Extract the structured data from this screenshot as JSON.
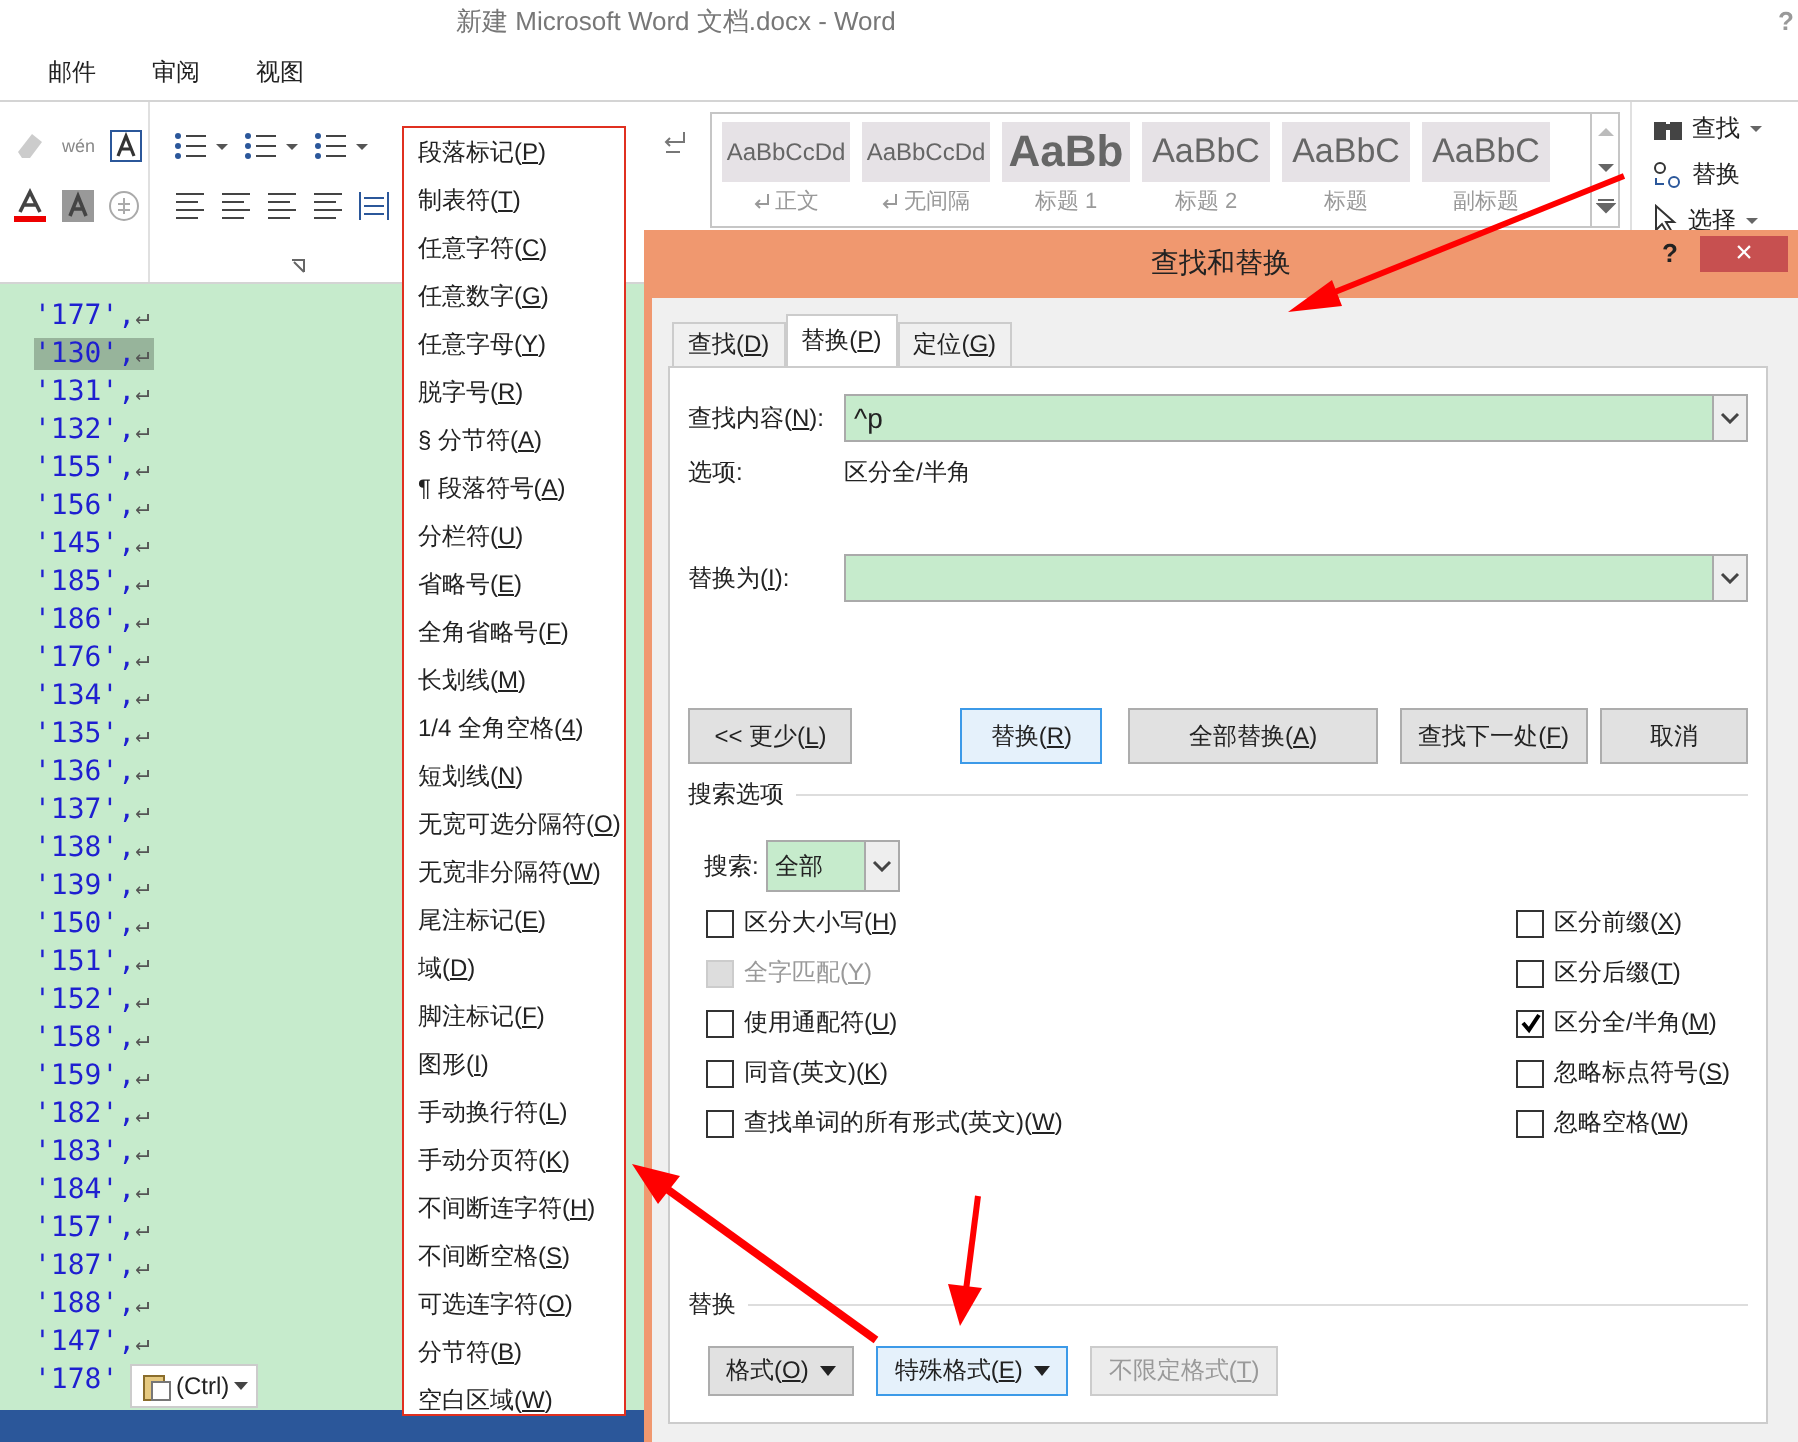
{
  "window": {
    "title": "新建 Microsoft Word 文档.docx - Word",
    "help": "?"
  },
  "ribbon_tabs": [
    {
      "label": "邮件"
    },
    {
      "label": "审阅"
    },
    {
      "label": "视图"
    }
  ],
  "ribbon": {
    "pinyin_icon": "wén",
    "style_gallery": [
      {
        "sample": "AaBbCcDd",
        "name": "正文",
        "kind": "small",
        "para_mark": true
      },
      {
        "sample": "AaBbCcDd",
        "name": "无间隔",
        "kind": "small",
        "para_mark": true
      },
      {
        "sample": "AaBb",
        "name": "标题 1",
        "kind": "bold",
        "para_mark": false
      },
      {
        "sample": "AaBbC",
        "name": "标题 2",
        "kind": "large",
        "para_mark": false
      },
      {
        "sample": "AaBbC",
        "name": "标题",
        "kind": "large",
        "para_mark": false
      },
      {
        "sample": "AaBbC",
        "name": "副标题",
        "kind": "large",
        "para_mark": false
      }
    ],
    "editing": [
      {
        "label": "查找",
        "kind": "find",
        "dropdown": true
      },
      {
        "label": "替换",
        "kind": "replace",
        "dropdown": false
      },
      {
        "label": "选择",
        "kind": "select",
        "dropdown": true
      }
    ]
  },
  "document": {
    "lines": [
      {
        "text": "'177',",
        "mark": "↵",
        "selected": false
      },
      {
        "text": "'130',",
        "mark": "↵",
        "selected": true
      },
      {
        "text": "'131',",
        "mark": "↵",
        "selected": false
      },
      {
        "text": "'132',",
        "mark": "↵",
        "selected": false
      },
      {
        "text": "'155',",
        "mark": "↵",
        "selected": false
      },
      {
        "text": "'156',",
        "mark": "↵",
        "selected": false
      },
      {
        "text": "'145',",
        "mark": "↵",
        "selected": false
      },
      {
        "text": "'185',",
        "mark": "↵",
        "selected": false
      },
      {
        "text": "'186',",
        "mark": "↵",
        "selected": false
      },
      {
        "text": "'176',",
        "mark": "↵",
        "selected": false
      },
      {
        "text": "'134',",
        "mark": "↵",
        "selected": false
      },
      {
        "text": "'135',",
        "mark": "↵",
        "selected": false
      },
      {
        "text": "'136',",
        "mark": "↵",
        "selected": false
      },
      {
        "text": "'137',",
        "mark": "↵",
        "selected": false
      },
      {
        "text": "'138',",
        "mark": "↵",
        "selected": false
      },
      {
        "text": "'139',",
        "mark": "↵",
        "selected": false
      },
      {
        "text": "'150',",
        "mark": "↵",
        "selected": false
      },
      {
        "text": "'151',",
        "mark": "↵",
        "selected": false
      },
      {
        "text": "'152',",
        "mark": "↵",
        "selected": false
      },
      {
        "text": "'158',",
        "mark": "↵",
        "selected": false
      },
      {
        "text": "'159',",
        "mark": "↵",
        "selected": false
      },
      {
        "text": "'182',",
        "mark": "↵",
        "selected": false
      },
      {
        "text": "'183',",
        "mark": "↵",
        "selected": false
      },
      {
        "text": "'184',",
        "mark": "↵",
        "selected": false
      },
      {
        "text": "'157',",
        "mark": "↵",
        "selected": false
      },
      {
        "text": "'187',",
        "mark": "↵",
        "selected": false
      },
      {
        "text": "'188',",
        "mark": "↵",
        "selected": false
      },
      {
        "text": "'147',",
        "mark": "↵",
        "selected": false
      },
      {
        "text": "'178'",
        "selected": false
      }
    ],
    "paste_options": "(Ctrl)"
  },
  "special_menu": [
    "段落标记(P)",
    "制表符(T)",
    "任意字符(C)",
    "任意数字(G)",
    "任意字母(Y)",
    "脱字号(R)",
    "§ 分节符(A)",
    "¶ 段落符号(A)",
    "分栏符(U)",
    "省略号(E)",
    "全角省略号(F)",
    "长划线(M)",
    "1/4 全角空格(4)",
    "短划线(N)",
    "无宽可选分隔符(O)",
    "无宽非分隔符(W)",
    "尾注标记(E)",
    "域(D)",
    "脚注标记(F)",
    "图形(I)",
    "手动换行符(L)",
    "手动分页符(K)",
    "不间断连字符(H)",
    "不间断空格(S)",
    "可选连字符(O)",
    "分节符(B)",
    "空白区域(W)"
  ],
  "dialog": {
    "title": "查找和替换",
    "help": "?",
    "close": "×",
    "tabs": [
      {
        "label": "查找(D)",
        "selected": false
      },
      {
        "label": "替换(P)",
        "selected": true
      },
      {
        "label": "定位(G)",
        "selected": false
      }
    ],
    "find": {
      "label": "查找内容(N):",
      "value": "^p"
    },
    "options": {
      "label": "选项:",
      "value": "区分全/半角"
    },
    "replace": {
      "label": "替换为(I):"
    },
    "buttons": [
      {
        "label": "<< 更少(L)",
        "focused": false
      },
      {
        "label": "替换(R)",
        "focused": true
      },
      {
        "label": "全部替换(A)",
        "focused": false
      },
      {
        "label": "查找下一处(F)",
        "focused": false
      },
      {
        "label": "取消",
        "focused": false
      }
    ],
    "search_options": {
      "title": "搜索选项",
      "search_label": "搜索:",
      "search_value": "全部",
      "left": [
        {
          "label": "区分大小写(H)",
          "checked": false,
          "disabled": false
        },
        {
          "label": "全字匹配(Y)",
          "checked": false,
          "disabled": true
        },
        {
          "label": "使用通配符(U)",
          "checked": false,
          "disabled": false
        },
        {
          "label": "同音(英文)(K)",
          "checked": false,
          "disabled": false
        },
        {
          "label": "查找单词的所有形式(英文)(W)",
          "checked": false,
          "disabled": false
        }
      ],
      "right": [
        {
          "label": "区分前缀(X)",
          "checked": false,
          "disabled": false
        },
        {
          "label": "区分后缀(T)",
          "checked": false,
          "disabled": false
        },
        {
          "label": "区分全/半角(M)",
          "checked": true,
          "disabled": false
        },
        {
          "label": "忽略标点符号(S)",
          "checked": false,
          "disabled": false
        },
        {
          "label": "忽略空格(W)",
          "checked": false,
          "disabled": false
        }
      ]
    },
    "replace_section": {
      "title": "替换",
      "buttons": [
        {
          "label": "格式(O)",
          "dropdown": true,
          "focused": false,
          "disabled": false
        },
        {
          "label": "特殊格式(E)",
          "dropdown": true,
          "focused": true,
          "disabled": false
        },
        {
          "label": "不限定格式(T)",
          "dropdown": false,
          "focused": false,
          "disabled": true
        }
      ]
    }
  }
}
